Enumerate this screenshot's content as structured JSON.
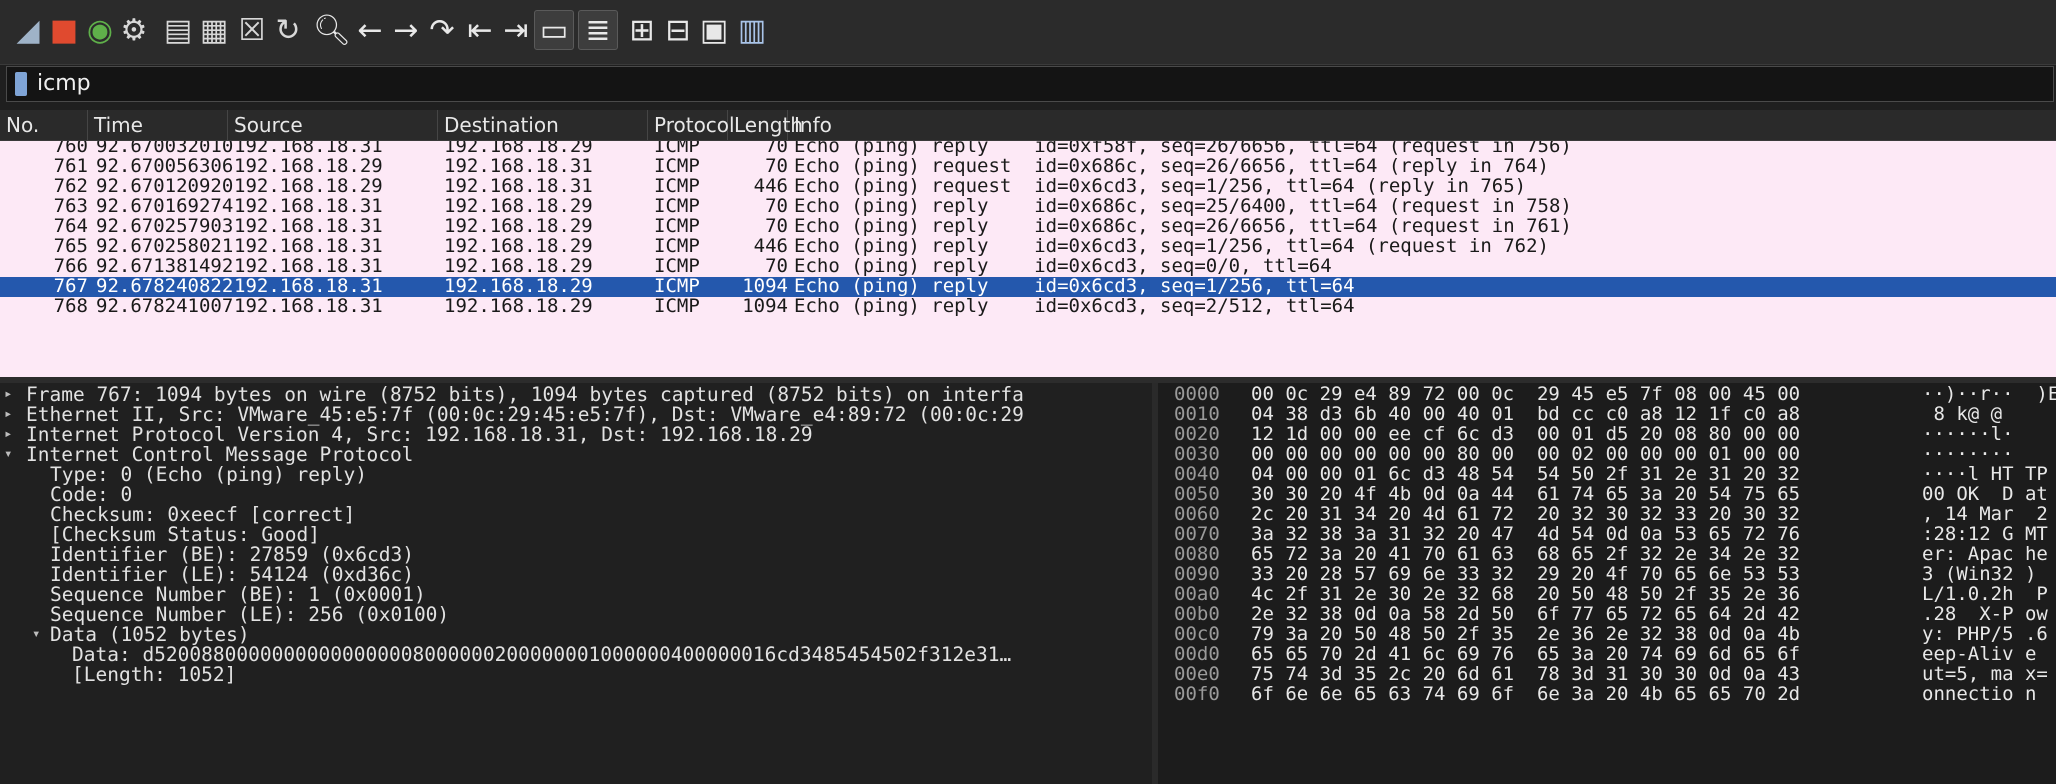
{
  "toolbar": {
    "buttons": [
      {
        "name": "shark-fin-start-icon",
        "glyph": "◢",
        "color": "#9fb3c8"
      },
      {
        "name": "stop-capture-icon",
        "glyph": "■",
        "color": "#e04a2f"
      },
      {
        "name": "restart-capture-icon",
        "glyph": "◉",
        "color": "#5fb04a"
      },
      {
        "name": "capture-options-icon",
        "glyph": "⚙",
        "color": "#d8d8d8"
      },
      {
        "name": "open-file-icon",
        "glyph": "▤",
        "color": "#d8d8d8"
      },
      {
        "name": "save-file-icon",
        "glyph": "▦",
        "color": "#d8d8d8"
      },
      {
        "name": "close-file-icon",
        "glyph": "☒",
        "color": "#d8d8d8"
      },
      {
        "name": "reload-file-icon",
        "glyph": "↻",
        "color": "#d8d8d8"
      },
      {
        "name": "find-packet-icon",
        "glyph": "🔍︎",
        "color": "#e8e8e8"
      },
      {
        "name": "go-back-icon",
        "glyph": "←",
        "color": "#e8e8e8"
      },
      {
        "name": "go-forward-icon",
        "glyph": "→",
        "color": "#e8e8e8"
      },
      {
        "name": "go-to-packet-icon",
        "glyph": "↷",
        "color": "#e8e8e8"
      },
      {
        "name": "first-packet-icon",
        "glyph": "⇤",
        "color": "#e8e8e8"
      },
      {
        "name": "last-packet-icon",
        "glyph": "⇥",
        "color": "#e8e8e8"
      },
      {
        "name": "autoscroll-icon",
        "glyph": "▭",
        "color": "#e8e8e8"
      },
      {
        "name": "colorize-icon",
        "glyph": "≣",
        "color": "#e8e8e8"
      },
      {
        "name": "zoom-in-icon",
        "glyph": "⊞",
        "color": "#e8e8e8"
      },
      {
        "name": "zoom-out-icon",
        "glyph": "⊟",
        "color": "#e8e8e8"
      },
      {
        "name": "normal-size-icon",
        "glyph": "▣",
        "color": "#e8e8e8"
      },
      {
        "name": "resize-columns-icon",
        "glyph": "▥",
        "color": "#a9c4e8"
      }
    ]
  },
  "filter": {
    "value": "icmp"
  },
  "columns": {
    "no": "No.",
    "time": "Time",
    "source": "Source",
    "destination": "Destination",
    "protocol": "Protocol",
    "length": "Length",
    "info": "Info"
  },
  "packets": [
    {
      "no": "760",
      "time": "92.670032010",
      "src": "192.168.18.31",
      "dst": "192.168.18.29",
      "proto": "ICMP",
      "len": "70",
      "info": "Echo (ping) reply    id=0xf58f, seq=26/6656, ttl=64 (request in 756)",
      "selected": false
    },
    {
      "no": "761",
      "time": "92.670056306",
      "src": "192.168.18.29",
      "dst": "192.168.18.31",
      "proto": "ICMP",
      "len": "70",
      "info": "Echo (ping) request  id=0x686c, seq=26/6656, ttl=64 (reply in 764)",
      "selected": false
    },
    {
      "no": "762",
      "time": "92.670120920",
      "src": "192.168.18.29",
      "dst": "192.168.18.31",
      "proto": "ICMP",
      "len": "446",
      "info": "Echo (ping) request  id=0x6cd3, seq=1/256, ttl=64 (reply in 765)",
      "selected": false
    },
    {
      "no": "763",
      "time": "92.670169274",
      "src": "192.168.18.31",
      "dst": "192.168.18.29",
      "proto": "ICMP",
      "len": "70",
      "info": "Echo (ping) reply    id=0x686c, seq=25/6400, ttl=64 (request in 758)",
      "selected": false
    },
    {
      "no": "764",
      "time": "92.670257903",
      "src": "192.168.18.31",
      "dst": "192.168.18.29",
      "proto": "ICMP",
      "len": "70",
      "info": "Echo (ping) reply    id=0x686c, seq=26/6656, ttl=64 (request in 761)",
      "selected": false
    },
    {
      "no": "765",
      "time": "92.670258021",
      "src": "192.168.18.31",
      "dst": "192.168.18.29",
      "proto": "ICMP",
      "len": "446",
      "info": "Echo (ping) reply    id=0x6cd3, seq=1/256, ttl=64 (request in 762)",
      "selected": false
    },
    {
      "no": "766",
      "time": "92.671381492",
      "src": "192.168.18.31",
      "dst": "192.168.18.29",
      "proto": "ICMP",
      "len": "70",
      "info": "Echo (ping) reply    id=0x6cd3, seq=0/0, ttl=64",
      "selected": false
    },
    {
      "no": "767",
      "time": "92.678240822",
      "src": "192.168.18.31",
      "dst": "192.168.18.29",
      "proto": "ICMP",
      "len": "1094",
      "info": "Echo (ping) reply    id=0x6cd3, seq=1/256, ttl=64",
      "selected": true
    },
    {
      "no": "768",
      "time": "92.678241007",
      "src": "192.168.18.31",
      "dst": "192.168.18.29",
      "proto": "ICMP",
      "len": "1094",
      "info": "Echo (ping) reply    id=0x6cd3, seq=2/512, ttl=64",
      "selected": false
    }
  ],
  "details": [
    {
      "text": "Frame 767: 1094 bytes on wire (8752 bits), 1094 bytes captured (8752 bits) on interfa",
      "indent": 0,
      "arrow": "▸"
    },
    {
      "text": "Ethernet II, Src: VMware_45:e5:7f (00:0c:29:45:e5:7f), Dst: VMware_e4:89:72 (00:0c:29",
      "indent": 0,
      "arrow": "▸"
    },
    {
      "text": "Internet Protocol Version 4, Src: 192.168.18.31, Dst: 192.168.18.29",
      "indent": 0,
      "arrow": "▸"
    },
    {
      "text": "Internet Control Message Protocol",
      "indent": 0,
      "arrow": "▾"
    },
    {
      "text": "Type: 0 (Echo (ping) reply)",
      "indent": 1,
      "arrow": ""
    },
    {
      "text": "Code: 0",
      "indent": 1,
      "arrow": ""
    },
    {
      "text": "Checksum: 0xeecf [correct]",
      "indent": 1,
      "arrow": ""
    },
    {
      "text": "[Checksum Status: Good]",
      "indent": 1,
      "arrow": ""
    },
    {
      "text": "Identifier (BE): 27859 (0x6cd3)",
      "indent": 1,
      "arrow": ""
    },
    {
      "text": "Identifier (LE): 54124 (0xd36c)",
      "indent": 1,
      "arrow": ""
    },
    {
      "text": "Sequence Number (BE): 1 (0x0001)",
      "indent": 1,
      "arrow": ""
    },
    {
      "text": "Sequence Number (LE): 256 (0x0100)",
      "indent": 1,
      "arrow": ""
    },
    {
      "text": "Data (1052 bytes)",
      "indent": 1,
      "arrow": "▾"
    },
    {
      "text": "Data: d52008800000000000000008000000200000001000000400000016cd3485454502f312e31…",
      "indent": 2,
      "arrow": ""
    },
    {
      "text": "[Length: 1052]",
      "indent": 2,
      "arrow": ""
    }
  ],
  "bytes": [
    {
      "off": "0000",
      "hex": "00 0c 29 e4 89 72 00 0c  29 45 e5 7f 08 00 45 00",
      "asc": "··)··r··  )E"
    },
    {
      "off": "0010",
      "hex": "04 38 d3 6b 40 00 40 01  bd cc c0 a8 12 1f c0 a8",
      "asc": " 8 k@ @"
    },
    {
      "off": "0020",
      "hex": "12 1d 00 00 ee cf 6c d3  00 01 d5 20 08 80 00 00",
      "asc": "······l·"
    },
    {
      "off": "0030",
      "hex": "00 00 00 00 00 00 80 00  00 02 00 00 00 01 00 00",
      "asc": "········"
    },
    {
      "off": "0040",
      "hex": "04 00 00 01 6c d3 48 54  54 50 2f 31 2e 31 20 32",
      "asc": "····l HT TP"
    },
    {
      "off": "0050",
      "hex": "30 30 20 4f 4b 0d 0a 44  61 74 65 3a 20 54 75 65",
      "asc": "00 OK  D at"
    },
    {
      "off": "0060",
      "hex": "2c 20 31 34 20 4d 61 72  20 32 30 32 33 20 30 32",
      "asc": ", 14 Mar  2"
    },
    {
      "off": "0070",
      "hex": "3a 32 38 3a 31 32 20 47  4d 54 0d 0a 53 65 72 76",
      "asc": ":28:12 G MT"
    },
    {
      "off": "0080",
      "hex": "65 72 3a 20 41 70 61 63  68 65 2f 32 2e 34 2e 32",
      "asc": "er: Apac he"
    },
    {
      "off": "0090",
      "hex": "33 20 28 57 69 6e 33 32  29 20 4f 70 65 6e 53 53",
      "asc": "3 (Win32 )"
    },
    {
      "off": "00a0",
      "hex": "4c 2f 31 2e 30 2e 32 68  20 50 48 50 2f 35 2e 36",
      "asc": "L/1.0.2h  P"
    },
    {
      "off": "00b0",
      "hex": "2e 32 38 0d 0a 58 2d 50  6f 77 65 72 65 64 2d 42",
      "asc": ".28  X-P ow"
    },
    {
      "off": "00c0",
      "hex": "79 3a 20 50 48 50 2f 35  2e 36 2e 32 38 0d 0a 4b",
      "asc": "y: PHP/5 .6"
    },
    {
      "off": "00d0",
      "hex": "65 65 70 2d 41 6c 69 76  65 3a 20 74 69 6d 65 6f",
      "asc": "eep-Aliv e"
    },
    {
      "off": "00e0",
      "hex": "75 74 3d 35 2c 20 6d 61  78 3d 31 30 30 0d 0a 43",
      "asc": "ut=5, ma x="
    },
    {
      "off": "00f0",
      "hex": "6f 6e 6e 65 63 74 69 6f  6e 3a 20 4b 65 65 70 2d",
      "asc": "onnectio n"
    }
  ],
  "colors": {
    "row_bg": "#fde9f6",
    "row_selected_bg": "#2458ad",
    "app_bg": "#1f1f1f"
  }
}
